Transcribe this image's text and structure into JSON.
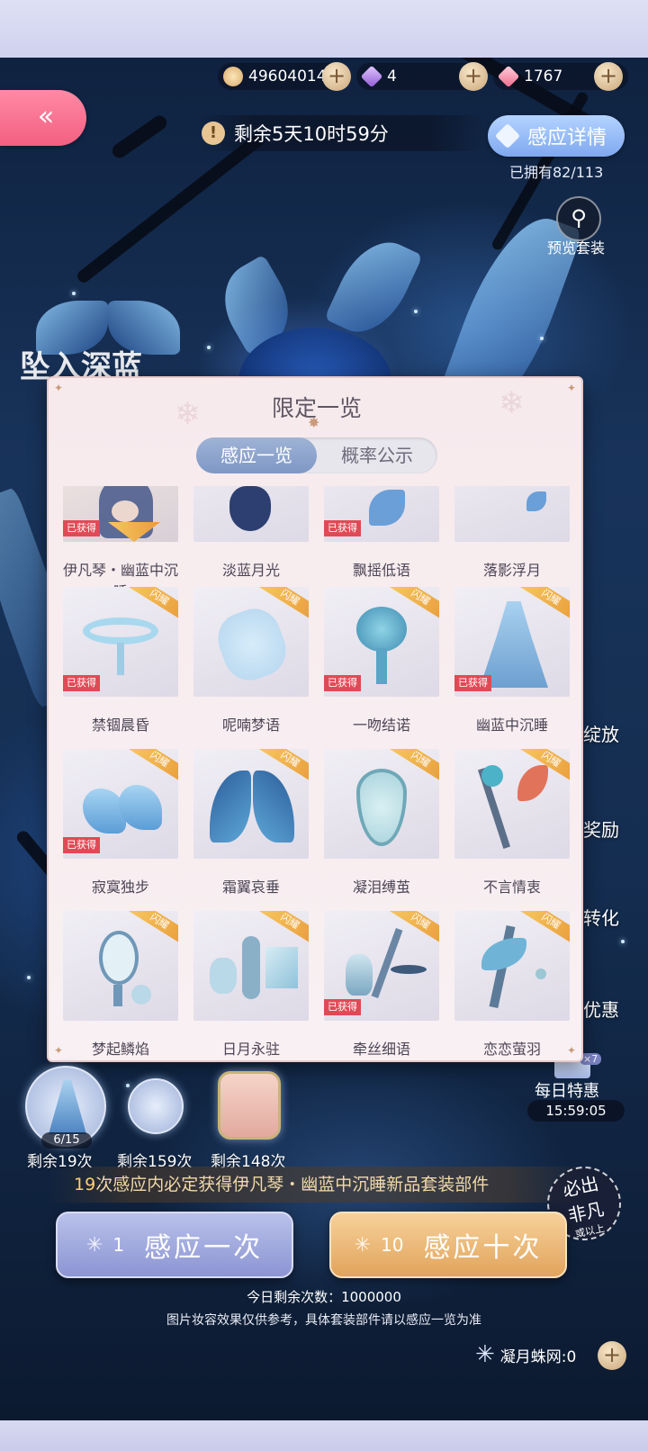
{
  "currencies": [
    {
      "name": "gold",
      "icon": "cat-coin-icon",
      "value": "49604014"
    },
    {
      "name": "purple-diamond",
      "icon": "purple-diamond-icon",
      "value": "4"
    },
    {
      "name": "pink-diamond",
      "icon": "pink-diamond-icon",
      "value": "1767"
    }
  ],
  "plus_label": "+",
  "back_label": "«",
  "timer": {
    "icon": "!",
    "text": "剩余5天10时59分"
  },
  "detail_button": "感应详情",
  "owned": "已拥有82/113",
  "preview_label": "预览套装",
  "side_rewards": [
    "绽放",
    "奖励",
    "转化",
    "优惠"
  ],
  "daily_deal": {
    "label": "每日特惠",
    "time": "15:59:05",
    "badge": "×7"
  },
  "deco_title": "坠入深蓝",
  "modal": {
    "title": "限定一览",
    "tabs": [
      "感应一览",
      "概率公示"
    ],
    "shine_label": "闪耀",
    "got_label": "已获得",
    "items": [
      {
        "name": "伊凡琴・幽蓝中沉睡",
        "got": true,
        "shine": false
      },
      {
        "name": "淡蓝月光",
        "got": false,
        "shine": false
      },
      {
        "name": "飘摇低语",
        "got": true,
        "shine": false
      },
      {
        "name": "落影浮月",
        "got": false,
        "shine": false
      },
      {
        "name": "禁锢晨昏",
        "got": true,
        "shine": true
      },
      {
        "name": "呢喃梦语",
        "got": false,
        "shine": true
      },
      {
        "name": "一吻结诺",
        "got": true,
        "shine": true
      },
      {
        "name": "幽蓝中沉睡",
        "got": true,
        "shine": true
      },
      {
        "name": "寂寞独步",
        "got": true,
        "shine": true
      },
      {
        "name": "霜翼哀垂",
        "got": false,
        "shine": true
      },
      {
        "name": "凝泪缚茧",
        "got": false,
        "shine": true
      },
      {
        "name": "不言情衷",
        "got": false,
        "shine": true
      },
      {
        "name": "梦起鳞焰",
        "got": false,
        "shine": true
      },
      {
        "name": "日月永驻",
        "got": false,
        "shine": true
      },
      {
        "name": "牵丝细语",
        "got": true,
        "shine": true
      },
      {
        "name": "恋恋萤羽",
        "got": false,
        "shine": true
      }
    ]
  },
  "progress": {
    "counter": "6/15"
  },
  "remaining": [
    "剩余19次",
    "剩余159次",
    "剩余148次"
  ],
  "banner": {
    "count": "19",
    "text": "次感应内必定获得伊凡琴・幽蓝中沉睡新品套装部件"
  },
  "stamp": [
    "必出",
    "非凡",
    "或以上"
  ],
  "draw_one": {
    "count": "1",
    "label": "感应一次"
  },
  "draw_ten": {
    "count": "10",
    "label": "感应十次"
  },
  "today_remaining": "今日剩余次数：1000000",
  "note": "图片妆容效果仅供参考，具体套装部件请以感应一览为准",
  "web_resource": "凝月蛛网:0",
  "colors": {
    "accent_pink": "#f35f81",
    "accent_blue": "#7e97c5",
    "gold": "#e1a45c",
    "got_red": "#e04a55"
  }
}
